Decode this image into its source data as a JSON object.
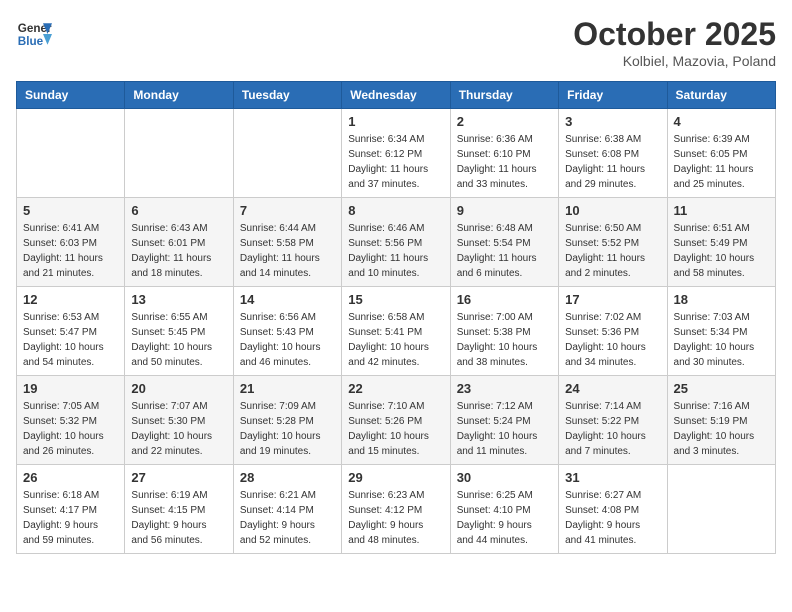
{
  "header": {
    "logo_line1": "General",
    "logo_line2": "Blue",
    "month_year": "October 2025",
    "location": "Kolbiel, Mazovia, Poland"
  },
  "weekdays": [
    "Sunday",
    "Monday",
    "Tuesday",
    "Wednesday",
    "Thursday",
    "Friday",
    "Saturday"
  ],
  "weeks": [
    [
      {
        "day": "",
        "info": ""
      },
      {
        "day": "",
        "info": ""
      },
      {
        "day": "",
        "info": ""
      },
      {
        "day": "1",
        "info": "Sunrise: 6:34 AM\nSunset: 6:12 PM\nDaylight: 11 hours\nand 37 minutes."
      },
      {
        "day": "2",
        "info": "Sunrise: 6:36 AM\nSunset: 6:10 PM\nDaylight: 11 hours\nand 33 minutes."
      },
      {
        "day": "3",
        "info": "Sunrise: 6:38 AM\nSunset: 6:08 PM\nDaylight: 11 hours\nand 29 minutes."
      },
      {
        "day": "4",
        "info": "Sunrise: 6:39 AM\nSunset: 6:05 PM\nDaylight: 11 hours\nand 25 minutes."
      }
    ],
    [
      {
        "day": "5",
        "info": "Sunrise: 6:41 AM\nSunset: 6:03 PM\nDaylight: 11 hours\nand 21 minutes."
      },
      {
        "day": "6",
        "info": "Sunrise: 6:43 AM\nSunset: 6:01 PM\nDaylight: 11 hours\nand 18 minutes."
      },
      {
        "day": "7",
        "info": "Sunrise: 6:44 AM\nSunset: 5:58 PM\nDaylight: 11 hours\nand 14 minutes."
      },
      {
        "day": "8",
        "info": "Sunrise: 6:46 AM\nSunset: 5:56 PM\nDaylight: 11 hours\nand 10 minutes."
      },
      {
        "day": "9",
        "info": "Sunrise: 6:48 AM\nSunset: 5:54 PM\nDaylight: 11 hours\nand 6 minutes."
      },
      {
        "day": "10",
        "info": "Sunrise: 6:50 AM\nSunset: 5:52 PM\nDaylight: 11 hours\nand 2 minutes."
      },
      {
        "day": "11",
        "info": "Sunrise: 6:51 AM\nSunset: 5:49 PM\nDaylight: 10 hours\nand 58 minutes."
      }
    ],
    [
      {
        "day": "12",
        "info": "Sunrise: 6:53 AM\nSunset: 5:47 PM\nDaylight: 10 hours\nand 54 minutes."
      },
      {
        "day": "13",
        "info": "Sunrise: 6:55 AM\nSunset: 5:45 PM\nDaylight: 10 hours\nand 50 minutes."
      },
      {
        "day": "14",
        "info": "Sunrise: 6:56 AM\nSunset: 5:43 PM\nDaylight: 10 hours\nand 46 minutes."
      },
      {
        "day": "15",
        "info": "Sunrise: 6:58 AM\nSunset: 5:41 PM\nDaylight: 10 hours\nand 42 minutes."
      },
      {
        "day": "16",
        "info": "Sunrise: 7:00 AM\nSunset: 5:38 PM\nDaylight: 10 hours\nand 38 minutes."
      },
      {
        "day": "17",
        "info": "Sunrise: 7:02 AM\nSunset: 5:36 PM\nDaylight: 10 hours\nand 34 minutes."
      },
      {
        "day": "18",
        "info": "Sunrise: 7:03 AM\nSunset: 5:34 PM\nDaylight: 10 hours\nand 30 minutes."
      }
    ],
    [
      {
        "day": "19",
        "info": "Sunrise: 7:05 AM\nSunset: 5:32 PM\nDaylight: 10 hours\nand 26 minutes."
      },
      {
        "day": "20",
        "info": "Sunrise: 7:07 AM\nSunset: 5:30 PM\nDaylight: 10 hours\nand 22 minutes."
      },
      {
        "day": "21",
        "info": "Sunrise: 7:09 AM\nSunset: 5:28 PM\nDaylight: 10 hours\nand 19 minutes."
      },
      {
        "day": "22",
        "info": "Sunrise: 7:10 AM\nSunset: 5:26 PM\nDaylight: 10 hours\nand 15 minutes."
      },
      {
        "day": "23",
        "info": "Sunrise: 7:12 AM\nSunset: 5:24 PM\nDaylight: 10 hours\nand 11 minutes."
      },
      {
        "day": "24",
        "info": "Sunrise: 7:14 AM\nSunset: 5:22 PM\nDaylight: 10 hours\nand 7 minutes."
      },
      {
        "day": "25",
        "info": "Sunrise: 7:16 AM\nSunset: 5:19 PM\nDaylight: 10 hours\nand 3 minutes."
      }
    ],
    [
      {
        "day": "26",
        "info": "Sunrise: 6:18 AM\nSunset: 4:17 PM\nDaylight: 9 hours\nand 59 minutes."
      },
      {
        "day": "27",
        "info": "Sunrise: 6:19 AM\nSunset: 4:15 PM\nDaylight: 9 hours\nand 56 minutes."
      },
      {
        "day": "28",
        "info": "Sunrise: 6:21 AM\nSunset: 4:14 PM\nDaylight: 9 hours\nand 52 minutes."
      },
      {
        "day": "29",
        "info": "Sunrise: 6:23 AM\nSunset: 4:12 PM\nDaylight: 9 hours\nand 48 minutes."
      },
      {
        "day": "30",
        "info": "Sunrise: 6:25 AM\nSunset: 4:10 PM\nDaylight: 9 hours\nand 44 minutes."
      },
      {
        "day": "31",
        "info": "Sunrise: 6:27 AM\nSunset: 4:08 PM\nDaylight: 9 hours\nand 41 minutes."
      },
      {
        "day": "",
        "info": ""
      }
    ]
  ]
}
